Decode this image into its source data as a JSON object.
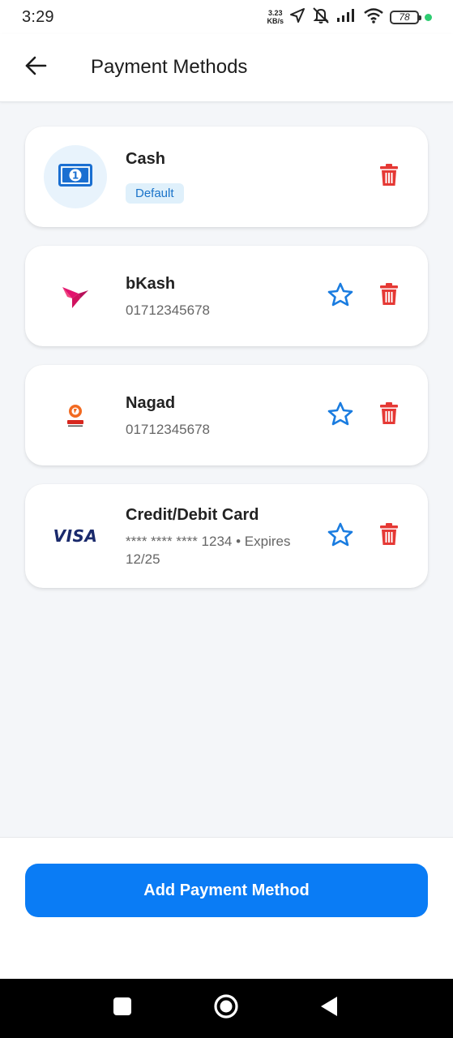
{
  "status_bar": {
    "time": "3:29",
    "net_speed_value": "3.23",
    "net_speed_unit": "KB/s",
    "battery": "78"
  },
  "header": {
    "title": "Payment Methods"
  },
  "methods": [
    {
      "name": "Cash",
      "badge": "Default",
      "logo": "cash-icon"
    },
    {
      "name": "bKash",
      "detail": "01712345678",
      "logo": "bkash-logo"
    },
    {
      "name": "Nagad",
      "detail": "01712345678",
      "logo": "nagad-logo"
    },
    {
      "name": "Credit/Debit Card",
      "detail": "**** **** **** 1234 • Expires 12/25",
      "logo": "visa-logo",
      "logo_text": "VISA"
    }
  ],
  "actions": {
    "add_label": "Add Payment Method"
  },
  "colors": {
    "accent": "#0a7cf5",
    "delete": "#e53935",
    "badge_bg": "#dff0fb",
    "badge_text": "#1a73c9"
  }
}
